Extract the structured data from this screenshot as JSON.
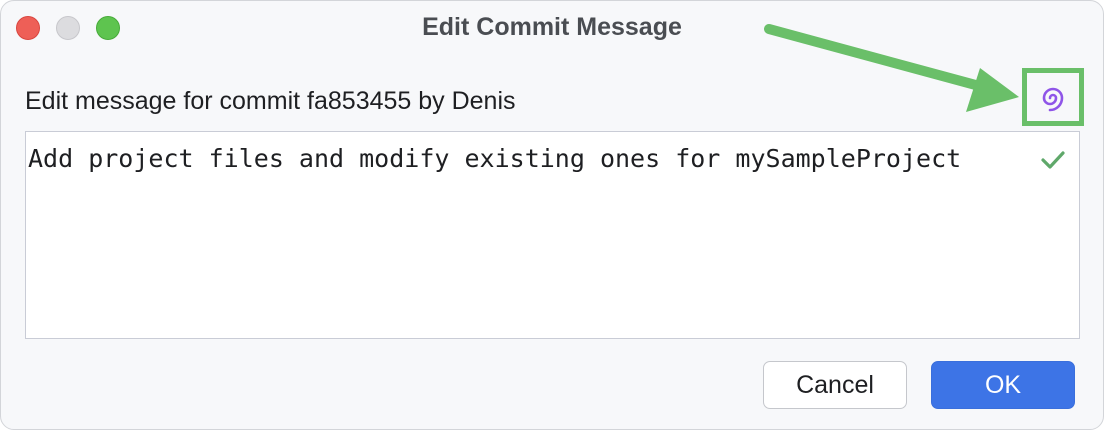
{
  "window": {
    "title": "Edit Commit Message"
  },
  "dialog": {
    "prompt": "Edit message for commit fa853455 by Denis",
    "message": "Add project files and modify existing ones for mySampleProject"
  },
  "buttons": {
    "cancel_label": "Cancel",
    "ok_label": "OK"
  },
  "icons": {
    "ai_assistant": "ai-spiral-icon",
    "spellcheck": "checkmark-icon"
  },
  "colors": {
    "highlight": "#6abf69",
    "accent": "#3d74e6",
    "ai_icon": "#8f55e8",
    "check": "#5fa86a"
  }
}
